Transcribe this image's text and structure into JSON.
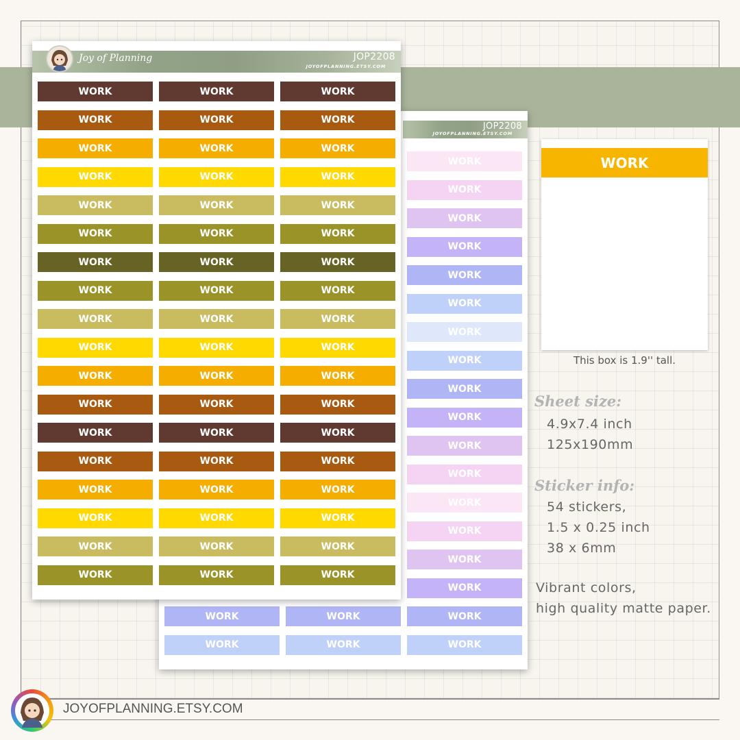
{
  "brand": "Joy of Planning",
  "code": "JOP2208",
  "url_small": "JOYOFPLANNING.ETSY.COM",
  "sticker_label": "WORK",
  "front_colors": [
    "#603a31",
    "#a85a11",
    "#f5ad00",
    "#ffd900",
    "#c9bb60",
    "#9a9328",
    "#666324",
    "#9a9328",
    "#c9bb60",
    "#ffd900",
    "#f5ad00",
    "#a85a11",
    "#603a31",
    "#a85a11",
    "#f5ad00",
    "#ffd900",
    "#c9bb60",
    "#9a9328"
  ],
  "back_colors": [
    "#fbe6f6",
    "#f5d3f3",
    "#dfc4f2",
    "#c4b3f6",
    "#b0b5f6",
    "#bfd1f8",
    "#dfe8fb",
    "#bfd1f8",
    "#b0b5f6",
    "#c4b3f6",
    "#dfc4f2",
    "#f5d3f3",
    "#fbe6f6",
    "#f5d3f3",
    "#dfc4f2",
    "#c4b3f6",
    "#b0b5f6",
    "#bfd1f8"
  ],
  "size_box": {
    "label": "WORK",
    "color": "#f7b500",
    "caption": "This box is 1.9'' tall."
  },
  "info": {
    "sheet_size_heading": "Sheet size:",
    "sheet_size_lines": [
      "4.9x7.4 inch",
      "125x190mm"
    ],
    "sticker_info_heading": "Sticker info:",
    "sticker_info_lines": [
      "54 stickers,",
      "1.5 x 0.25 inch",
      "38 x 6mm"
    ],
    "notes": [
      "Vibrant colors,",
      "high quality matte paper."
    ]
  },
  "footer": {
    "url": "JOYOFPLANNING.ETSY.COM"
  },
  "icons": [
    "avatar-icon",
    "rainbow-avatar-icon"
  ]
}
